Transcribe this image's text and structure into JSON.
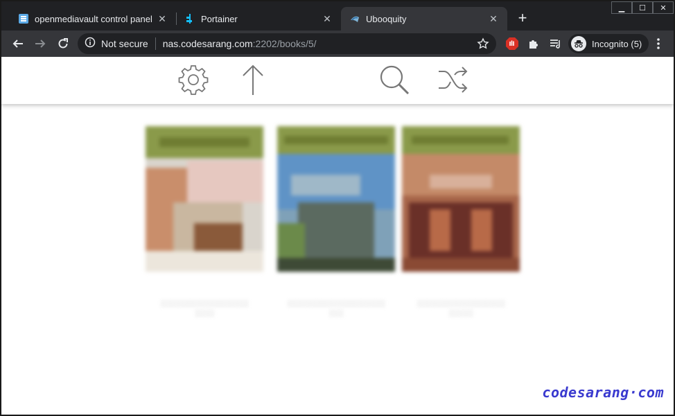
{
  "tabs": [
    {
      "title": "openmediavault control panel - ",
      "active": false,
      "favicon": "omv-icon"
    },
    {
      "title": "Portainer",
      "active": false,
      "favicon": "portainer-icon"
    },
    {
      "title": "Ubooquity",
      "active": true,
      "favicon": "ubooquity-icon"
    }
  ],
  "toolbar": {
    "security_label": "Not secure",
    "url_host": "nas.codesarang.com",
    "url_path": ":2202/books/5/",
    "profile_label": "Incognito (5)"
  },
  "app": {
    "icons": [
      "settings-gear-icon",
      "up-arrow-icon",
      "search-icon",
      "shuffle-icon"
    ]
  },
  "books": [
    {
      "caption_line1": "",
      "caption_line2": ""
    },
    {
      "caption_line1": "",
      "caption_line2": ""
    },
    {
      "caption_line1": "",
      "caption_line2": ""
    }
  ],
  "watermark": "codesarang·com",
  "colors": {
    "chrome_dark": "#202124",
    "chrome_toolbar": "#35363a",
    "watermark": "#3a3acf",
    "icon_gray": "#777777"
  }
}
